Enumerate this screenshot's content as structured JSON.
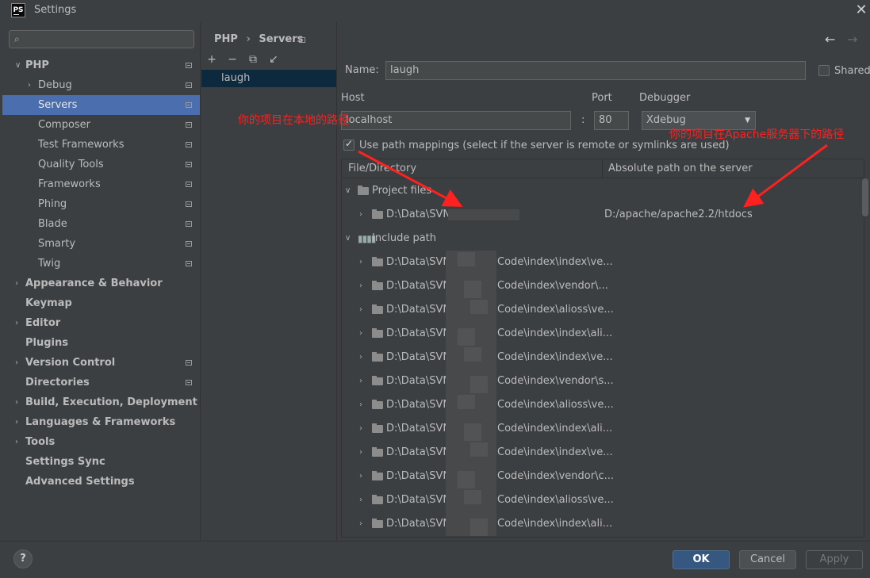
{
  "window": {
    "title": "Settings",
    "logo": "PS"
  },
  "search": {
    "placeholder": ""
  },
  "sidebar": {
    "items": [
      {
        "label": "PHP",
        "chev": "∨",
        "bold": true,
        "level": 0,
        "proj": true
      },
      {
        "label": "Debug",
        "chev": "›",
        "level": 1,
        "proj": true
      },
      {
        "label": "Servers",
        "level": 1,
        "proj": true,
        "selected": true
      },
      {
        "label": "Composer",
        "level": 1,
        "proj": true
      },
      {
        "label": "Test Frameworks",
        "level": 1,
        "proj": true
      },
      {
        "label": "Quality Tools",
        "level": 1,
        "proj": true
      },
      {
        "label": "Frameworks",
        "level": 1,
        "proj": true
      },
      {
        "label": "Phing",
        "level": 1,
        "proj": true
      },
      {
        "label": "Blade",
        "level": 1,
        "proj": true
      },
      {
        "label": "Smarty",
        "level": 1,
        "proj": true
      },
      {
        "label": "Twig",
        "level": 1,
        "proj": true
      },
      {
        "label": "Appearance & Behavior",
        "chev": "›",
        "bold": true,
        "level": 0
      },
      {
        "label": "Keymap",
        "bold": true,
        "level": 0
      },
      {
        "label": "Editor",
        "chev": "›",
        "bold": true,
        "level": 0
      },
      {
        "label": "Plugins",
        "bold": true,
        "level": 0
      },
      {
        "label": "Version Control",
        "chev": "›",
        "bold": true,
        "level": 0,
        "proj": true
      },
      {
        "label": "Directories",
        "bold": true,
        "level": 0,
        "proj": true
      },
      {
        "label": "Build, Execution, Deployment",
        "chev": "›",
        "bold": true,
        "level": 0
      },
      {
        "label": "Languages & Frameworks",
        "chev": "›",
        "bold": true,
        "level": 0
      },
      {
        "label": "Tools",
        "chev": "›",
        "bold": true,
        "level": 0
      },
      {
        "label": "Settings Sync",
        "bold": true,
        "level": 0
      },
      {
        "label": "Advanced Settings",
        "bold": true,
        "level": 0
      }
    ]
  },
  "breadcrumb": {
    "parent": "PHP",
    "separator": "›",
    "current": "Servers"
  },
  "toolbar": {
    "add": "+",
    "remove": "−",
    "copy": "⧉",
    "import": "↙"
  },
  "servers": {
    "items": [
      "laugh"
    ]
  },
  "form": {
    "name_label": "Name:",
    "name_value": "laugh",
    "shared_label": "Shared",
    "host_label": "Host",
    "host_value": "localhost",
    "colon": ":",
    "port_label": "Port",
    "port_value": "80",
    "debugger_label": "Debugger",
    "debugger_value": "Xdebug",
    "path_mappings_label": "Use path mappings (select if the server is remote or symlinks are used)"
  },
  "annotations": {
    "local": "你的项目在本地的路径",
    "server": "你的项目在Apache服务器下的路径"
  },
  "table": {
    "col1": "File/Directory",
    "col2": "Absolute path on the server",
    "project_files": "Project files",
    "project_path": "D:\\Data\\SVN\\",
    "project_server_path": "D:/apache/apache2.2/htdocs",
    "include_path": "Include path",
    "include_prefix": "D:\\Data\\SVN",
    "include_rows": [
      "Code\\index\\index\\ve...",
      "Code\\index\\vendor\\...",
      "Code\\index\\alioss\\ve...",
      "Code\\index\\index\\ali...",
      "Code\\index\\index\\ve...",
      "Code\\index\\vendor\\s...",
      "Code\\index\\alioss\\ve...",
      "Code\\index\\index\\ali...",
      "Code\\index\\index\\ve...",
      "Code\\index\\vendor\\c...",
      "Code\\index\\alioss\\ve...",
      "Code\\index\\index\\ali..."
    ]
  },
  "footer": {
    "help": "?",
    "ok": "OK",
    "cancel": "Cancel",
    "apply": "Apply"
  },
  "colors": {
    "accent": "#4b6eaf",
    "ok_button": "#365880",
    "annotation": "#ff2020"
  }
}
